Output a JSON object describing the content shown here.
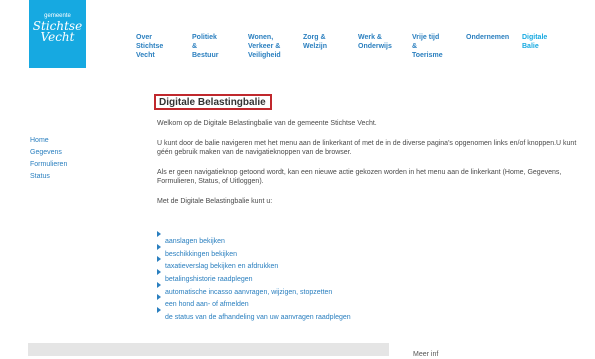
{
  "logo": {
    "line1": "gemeente",
    "line2": "Stichtse",
    "line3": "Vecht"
  },
  "topnav": [
    {
      "label": "Over Stichtse\nVecht"
    },
    {
      "label": "Politiek &\nBestuur"
    },
    {
      "label": "Wonen,\nVerkeer &\nVeiligheid"
    },
    {
      "label": "Zorg & Welzijn"
    },
    {
      "label": "Werk &\nOnderwijs"
    },
    {
      "label": "Vrije tijd &\nToerisme"
    },
    {
      "label": "Ondernemen"
    },
    {
      "label": "Digitale Balie"
    }
  ],
  "page_title": "Digitale Belastingbalie",
  "paragraphs": [
    "Welkom op de Digitale Belastingbalie van de gemeente Stichtse Vecht.",
    "U kunt door de balie navigeren met het menu aan de linkerkant of met de in de diverse pagina's opgenomen links en/of knoppen.U kunt géén gebruik maken van de navigatieknoppen van de browser.",
    "Als er geen navigatieknop getoond wordt, kan een nieuwe actie gekozen worden in het menu aan de linkerkant (Home, Gegevens, Formulieren, Status, of Uitloggen).",
    "Met de Digitale Belastingbalie kunt u:"
  ],
  "sidebar": [
    "Home",
    "Gegevens",
    "Formulieren",
    "Status"
  ],
  "links": [
    "aanslagen bekijken",
    "beschikkingen bekijken",
    "taxatieverslag bekijken en afdrukken",
    "betalingshistorie raadplegen",
    "automatische incasso aanvragen, wijzigen, stopzetten",
    "een hond aan- of afmelden",
    "de status van de afhandeling van uw aanvragen raadplegen"
  ],
  "footer_text": "Meer inf"
}
